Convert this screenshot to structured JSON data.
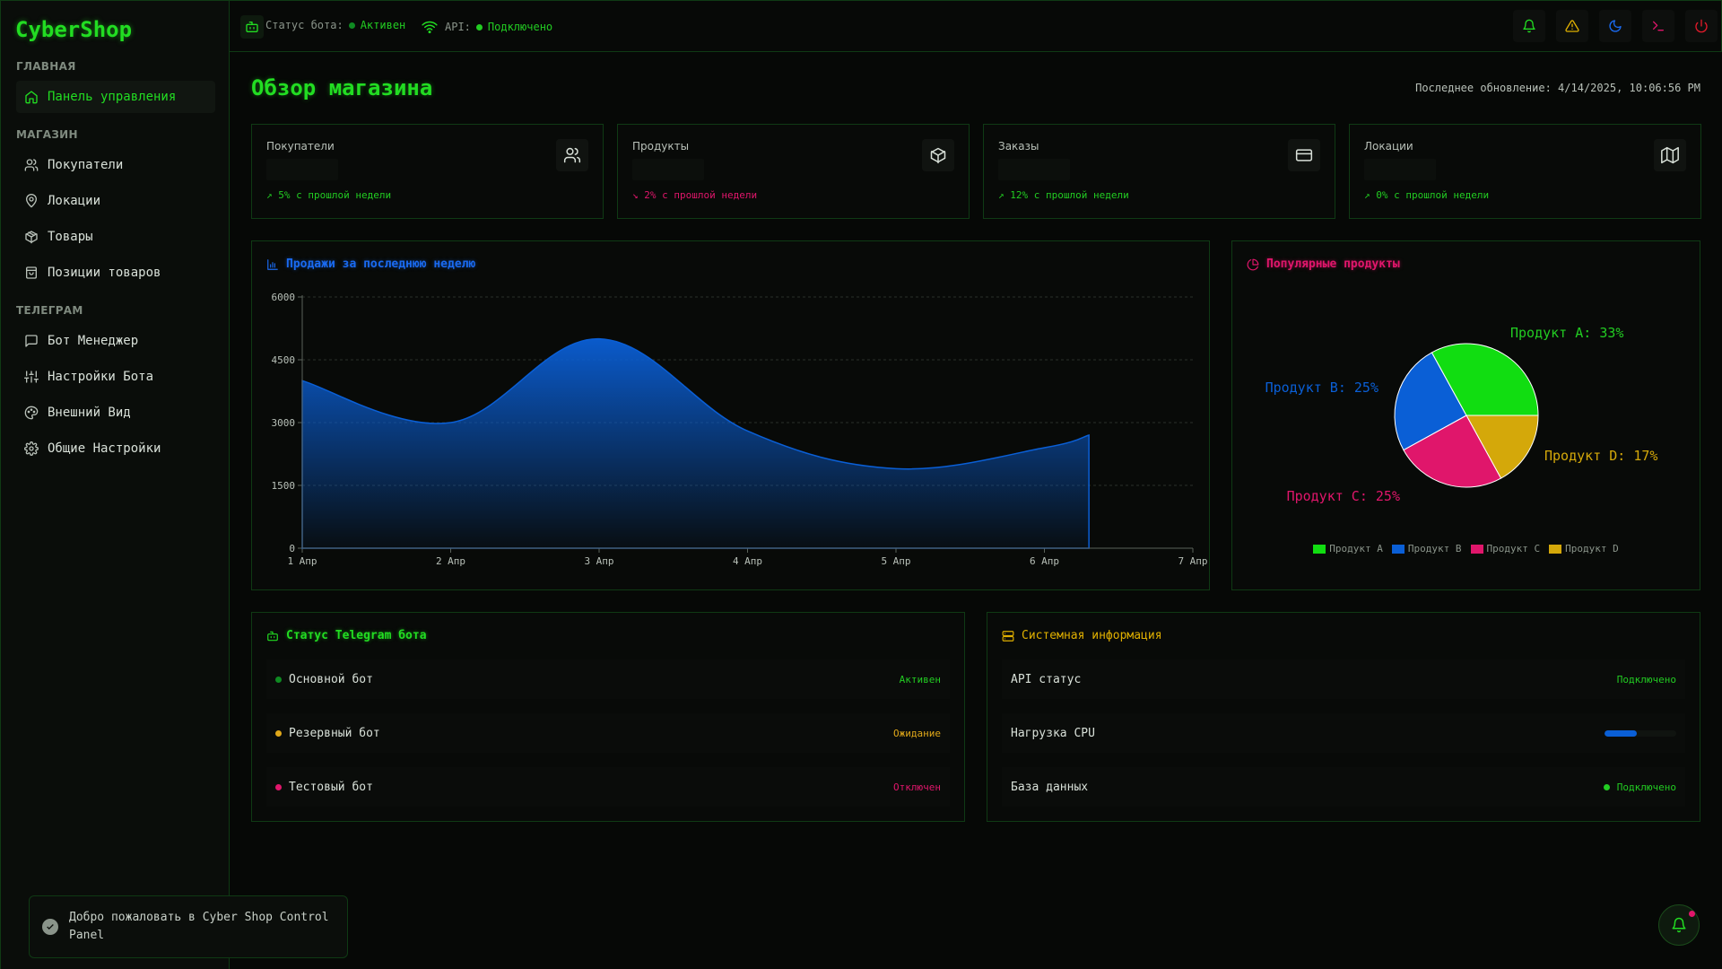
{
  "app": {
    "logo": "CyberShop"
  },
  "sidebar": {
    "sections": [
      {
        "title": "ГЛАВНАЯ",
        "items": [
          {
            "label": "Панель управления",
            "icon": "home-icon",
            "active": true
          }
        ]
      },
      {
        "title": "МАГАЗИН",
        "items": [
          {
            "label": "Покупатели",
            "icon": "users-icon"
          },
          {
            "label": "Локации",
            "icon": "map-pin-icon"
          },
          {
            "label": "Товары",
            "icon": "package-icon"
          },
          {
            "label": "Позиции товаров",
            "icon": "shopping-bag-icon"
          }
        ]
      },
      {
        "title": "ТЕЛЕГРАМ",
        "items": [
          {
            "label": "Бот Менеджер",
            "icon": "message-square-icon"
          },
          {
            "label": "Настройки Бота",
            "icon": "sliders-icon"
          },
          {
            "label": "Внешний Вид",
            "icon": "palette-icon"
          },
          {
            "label": "Общие Настройки",
            "icon": "gear-icon"
          }
        ]
      }
    ]
  },
  "topbar": {
    "bot_status_label": "Статус бота:",
    "bot_status_value": "Активен",
    "api_label": "API:",
    "api_value": "Подключено",
    "icons": [
      "bell-icon",
      "alert-triangle-icon",
      "moon-icon",
      "terminal-icon",
      "power-icon"
    ]
  },
  "page": {
    "title": "Обзор магазина",
    "last_update_label": "Последнее обновление:",
    "last_update_value": "4/14/2025, 10:06:56 PM"
  },
  "stats": [
    {
      "label": "Покупатели",
      "change": "5% с прошлой недели",
      "trend": "up",
      "icon": "users-icon"
    },
    {
      "label": "Продукты",
      "change": "2% с прошлой недели",
      "trend": "down",
      "icon": "box-icon"
    },
    {
      "label": "Заказы",
      "change": "12% с прошлой недели",
      "trend": "up",
      "icon": "credit-card-icon"
    },
    {
      "label": "Локации",
      "change": "0% с прошлой недели",
      "trend": "up",
      "icon": "map-icon"
    }
  ],
  "sales_panel": {
    "title": "Продажи за последнюю неделю"
  },
  "popular_panel": {
    "title": "Популярные продукты"
  },
  "telegram_panel": {
    "title": "Статус Telegram бота",
    "rows": [
      {
        "name": "Основной бот",
        "status": "Активен",
        "color": "#22cc22"
      },
      {
        "name": "Резервный бот",
        "status": "Ожидание",
        "color": "#e0a81a"
      },
      {
        "name": "Тестовый бот",
        "status": "Отключен",
        "color": "#e0166b"
      }
    ]
  },
  "system_panel": {
    "title": "Системная информация",
    "api_label": "API статус",
    "api_value": "Подключено",
    "cpu_label": "Нагрузка CPU",
    "cpu_load": 0.45,
    "db_label": "База данных",
    "db_value": "Подключено"
  },
  "toast": {
    "message": "Добро пожаловать в Cyber Shop Control Panel"
  },
  "colors": {
    "accent": "#22dd22",
    "blue": "#0a5fd6",
    "pink": "#e0166b",
    "yellow": "#d4a80a"
  },
  "chart_data": [
    {
      "type": "area",
      "categories": [
        "1 Апр",
        "2 Апр",
        "3 Апр",
        "4 Апр",
        "5 Апр",
        "6 Апр",
        "7 Апр"
      ],
      "x": [
        "1 Апр",
        "2 Апр",
        "3 Апр",
        "4 Апр",
        "5 Апр",
        "6 Апр",
        "6.3 Апр"
      ],
      "values": [
        4000,
        3000,
        5000,
        2800,
        1900,
        2400,
        2700
      ],
      "ylim": [
        0,
        6000
      ],
      "yticks": [
        0,
        1500,
        3000,
        4500,
        6000
      ],
      "grid": true
    },
    {
      "type": "pie",
      "categories": [
        "Продукт A",
        "Продукт B",
        "Продукт C",
        "Продукт D"
      ],
      "values": [
        33,
        25,
        25,
        17
      ],
      "slice_labels": [
        "Продукт A: 33%",
        "Продукт B: 25%",
        "Продукт C: 25%",
        "Продукт D: 17%"
      ],
      "colors": [
        "#11dd11",
        "#0a5fd6",
        "#e0166b",
        "#d4a80a"
      ],
      "legend": "bottom"
    }
  ]
}
